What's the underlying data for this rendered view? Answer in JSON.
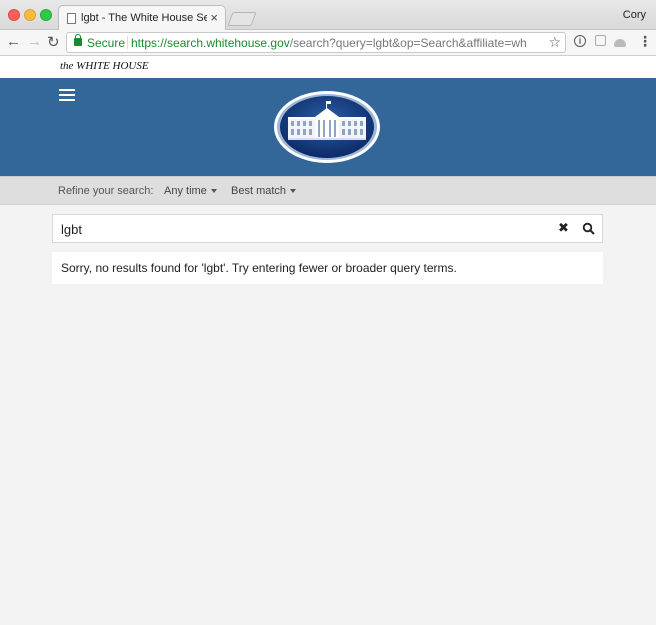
{
  "browser": {
    "tab_title": "lgbt - The White House Search",
    "tab_close": "×",
    "user": "Cory",
    "secure_label": "Secure",
    "url_host": "https://search.whitehouse.gov",
    "url_path": "/search?query=lgbt&op=Search&affiliate=wh",
    "back": "←",
    "forward": "→",
    "reload": "↻",
    "star": "☆",
    "ext1": "i",
    "menu": "⋮"
  },
  "site": {
    "wordmark": "the WHITE HOUSE",
    "brand_color": "#336699"
  },
  "refine": {
    "label": "Refine your search:",
    "time_option": "Any time",
    "sort_option": "Best match"
  },
  "search": {
    "query": "lgbt",
    "clear": "✖"
  },
  "results": {
    "message": "Sorry, no results found for 'lgbt'. Try entering fewer or broader query terms."
  }
}
